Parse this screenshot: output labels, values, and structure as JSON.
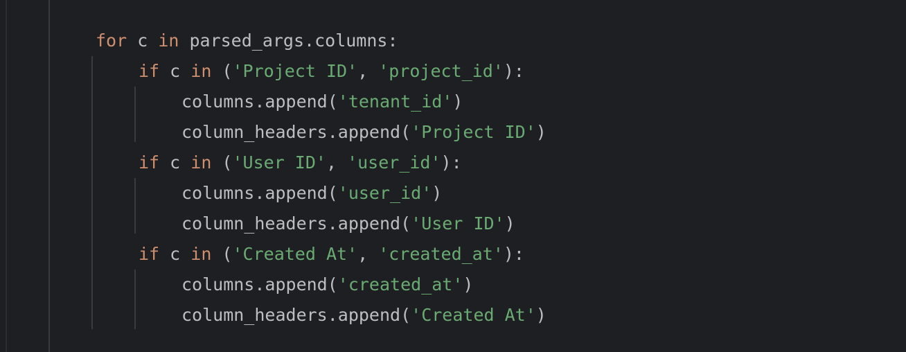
{
  "editor": {
    "colors": {
      "background": "#1e1f22",
      "text": "#bcbec4",
      "keyword": "#cf8e6d",
      "string": "#6aab73"
    },
    "lines": [
      {
        "tokens": [
          {
            "t": "kw",
            "v": "for"
          },
          {
            "t": "plain",
            "v": " c "
          },
          {
            "t": "kw",
            "v": "in"
          },
          {
            "t": "plain",
            "v": " parsed_args.columns:"
          }
        ]
      },
      {
        "tokens": [
          {
            "t": "kw",
            "v": "if"
          },
          {
            "t": "plain",
            "v": " c "
          },
          {
            "t": "kw",
            "v": "in"
          },
          {
            "t": "plain",
            "v": " ("
          },
          {
            "t": "str",
            "v": "'Project ID'"
          },
          {
            "t": "plain",
            "v": ", "
          },
          {
            "t": "str",
            "v": "'project_id'"
          },
          {
            "t": "plain",
            "v": "):"
          }
        ]
      },
      {
        "tokens": [
          {
            "t": "plain",
            "v": "columns.append("
          },
          {
            "t": "str",
            "v": "'tenant_id'"
          },
          {
            "t": "plain",
            "v": ")"
          }
        ]
      },
      {
        "tokens": [
          {
            "t": "plain",
            "v": "column_headers.append("
          },
          {
            "t": "str",
            "v": "'Project ID'"
          },
          {
            "t": "plain",
            "v": ")"
          }
        ]
      },
      {
        "tokens": [
          {
            "t": "kw",
            "v": "if"
          },
          {
            "t": "plain",
            "v": " c "
          },
          {
            "t": "kw",
            "v": "in"
          },
          {
            "t": "plain",
            "v": " ("
          },
          {
            "t": "str",
            "v": "'User ID'"
          },
          {
            "t": "plain",
            "v": ", "
          },
          {
            "t": "str",
            "v": "'user_id'"
          },
          {
            "t": "plain",
            "v": "):"
          }
        ]
      },
      {
        "tokens": [
          {
            "t": "plain",
            "v": "columns.append("
          },
          {
            "t": "str",
            "v": "'user_id'"
          },
          {
            "t": "plain",
            "v": ")"
          }
        ]
      },
      {
        "tokens": [
          {
            "t": "plain",
            "v": "column_headers.append("
          },
          {
            "t": "str",
            "v": "'User ID'"
          },
          {
            "t": "plain",
            "v": ")"
          }
        ]
      },
      {
        "tokens": [
          {
            "t": "kw",
            "v": "if"
          },
          {
            "t": "plain",
            "v": " c "
          },
          {
            "t": "kw",
            "v": "in"
          },
          {
            "t": "plain",
            "v": " ("
          },
          {
            "t": "str",
            "v": "'Created At'"
          },
          {
            "t": "plain",
            "v": ", "
          },
          {
            "t": "str",
            "v": "'created_at'"
          },
          {
            "t": "plain",
            "v": "):"
          }
        ]
      },
      {
        "tokens": [
          {
            "t": "plain",
            "v": "columns.append("
          },
          {
            "t": "str",
            "v": "'created_at'"
          },
          {
            "t": "plain",
            "v": ")"
          }
        ]
      },
      {
        "tokens": [
          {
            "t": "plain",
            "v": "column_headers.append("
          },
          {
            "t": "str",
            "v": "'Created At'"
          },
          {
            "t": "plain",
            "v": ")"
          }
        ]
      }
    ]
  }
}
